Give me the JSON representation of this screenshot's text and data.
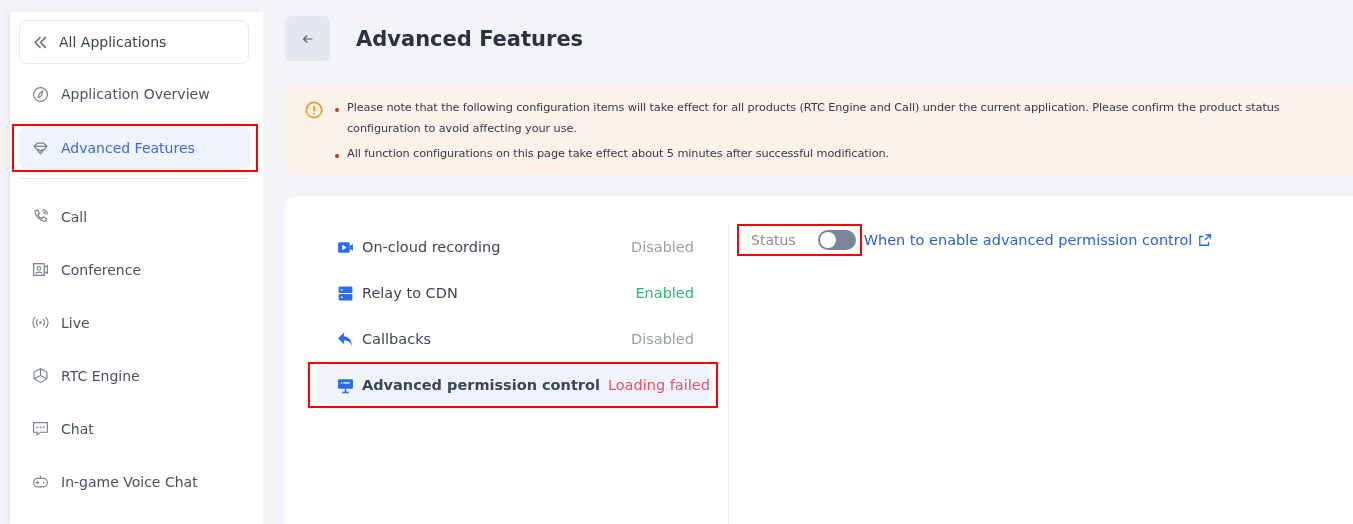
{
  "sidebar": {
    "back": {
      "label": "All Applications"
    },
    "top_items": [
      {
        "label": "Application Overview",
        "kind": "compass",
        "selected": false,
        "highlighted": false
      },
      {
        "label": "Advanced Features",
        "kind": "diamond",
        "selected": true,
        "highlighted": true
      }
    ],
    "items": [
      {
        "label": "Call",
        "kind": "phone",
        "selected": false
      },
      {
        "label": "Conference",
        "kind": "conference",
        "selected": false
      },
      {
        "label": "Live",
        "kind": "live",
        "selected": false
      },
      {
        "label": "RTC Engine",
        "kind": "cube",
        "selected": false
      },
      {
        "label": "Chat",
        "kind": "chat",
        "selected": false
      },
      {
        "label": "In-game Voice Chat",
        "kind": "gamepad",
        "selected": false
      }
    ]
  },
  "page": {
    "title": "Advanced Features"
  },
  "notice": {
    "lines": [
      [
        "Please note that the following configuration items will take effect for all products (RTC Engine and Call) under the current application. Please confirm the product status",
        "configuration to avoid affecting your use."
      ],
      [
        "All function configurations on this page take effect about 5 minutes after successful modification."
      ]
    ]
  },
  "features": [
    {
      "label": "On-cloud recording",
      "kind": "video",
      "status": "Disabled",
      "color": "#9aa0aa",
      "selected": false,
      "highlighted": false
    },
    {
      "label": "Relay to CDN",
      "kind": "server",
      "status": "Enabled",
      "color": "#2bb673",
      "selected": false,
      "highlighted": false
    },
    {
      "label": "Callbacks",
      "kind": "reply",
      "status": "Disabled",
      "color": "#9aa0aa",
      "selected": false,
      "highlighted": false
    },
    {
      "label": "Advanced permission control",
      "kind": "monitor",
      "status": "Loading failed",
      "color": "#f0505f",
      "selected": true,
      "highlighted": true
    }
  ],
  "detail": {
    "status_label": "Status",
    "on": false,
    "highlighted": true,
    "link": "When to enable advanced permission control"
  }
}
